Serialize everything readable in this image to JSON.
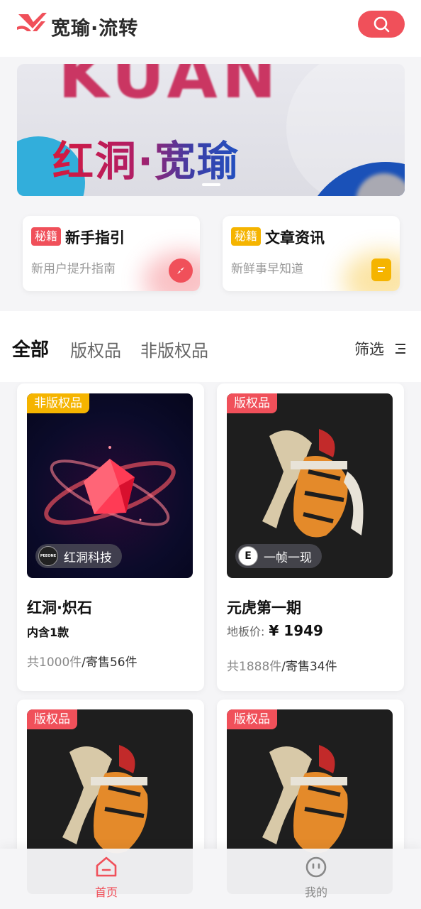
{
  "header": {
    "brand": "宽瑜·流转",
    "search_icon": "search-icon"
  },
  "banner": {
    "bg_text": "KUAN",
    "slogan": "红洞·宽瑜"
  },
  "quick_cards": [
    {
      "tag": "秘籍",
      "title": "新手指引",
      "subtitle": "新用户提升指南",
      "icon": "compass-icon",
      "accent": "#f0505a"
    },
    {
      "tag": "秘籍",
      "title": "文章资讯",
      "subtitle": "新鲜事早知道",
      "icon": "document-icon",
      "accent": "#f5b400"
    }
  ],
  "filters": {
    "tabs": [
      {
        "label": "全部",
        "active": true
      },
      {
        "label": "版权品",
        "active": false
      },
      {
        "label": "非版权品",
        "active": false
      }
    ],
    "filter_label": "筛选"
  },
  "products": [
    {
      "badge": "非版权品",
      "badge_color": "#f5b400",
      "creator": "红洞科技",
      "creator_avatar": "PEEONE",
      "name": "红洞·炽石",
      "detail": "内含1款",
      "count_total": "共1000件",
      "count_sale": "/寄售56件"
    },
    {
      "badge": "版权品",
      "badge_color": "#f0505a",
      "creator": "一帧一现",
      "creator_avatar": "E",
      "name": "元虎第一期",
      "price_label": "地板价:",
      "price": "¥ 1949",
      "count_total": "共1888件",
      "count_sale": "/寄售34件"
    },
    {
      "badge": "版权品",
      "badge_color": "#f0505a"
    },
    {
      "badge": "版权品",
      "badge_color": "#f0505a"
    }
  ],
  "nav": [
    {
      "label": "首页",
      "icon": "home-icon",
      "active": true,
      "color": "#f0505a"
    },
    {
      "label": "我的",
      "icon": "profile-icon",
      "active": false,
      "color": "#888888"
    }
  ]
}
